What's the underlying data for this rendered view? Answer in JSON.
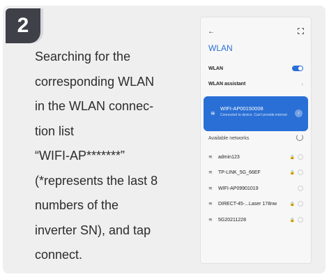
{
  "step": {
    "number": "2"
  },
  "instruction": {
    "lines": [
      "Searching for the",
      "corresponding WLAN",
      "in the WLAN connec-",
      "tion list",
      "“WIFI-AP*******”",
      "(*represents the last 8",
      "numbers of the",
      "inverter SN), and tap",
      "connect."
    ]
  },
  "phone": {
    "back": "←",
    "title": "WLAN",
    "wlan_label": "WLAN",
    "wlan_assistant": "WLAN assistant",
    "connected": {
      "ssid": "WIFI-AP00150008",
      "status": "Connected to device. Can't provide internet"
    },
    "available_label": "Available networks",
    "networks": [
      {
        "ssid": "admin123",
        "lock": "🔒"
      },
      {
        "ssid": "TP-LINK_5G_66EF",
        "lock": "🔒"
      },
      {
        "ssid": "WIFI-AP09901019",
        "lock": ""
      },
      {
        "ssid": "DIRECT-45-...Laser 178nw",
        "lock": "🔒"
      },
      {
        "ssid": "5G20211228",
        "lock": "🔒"
      }
    ]
  },
  "colors": {
    "accent": "#2a6fd6",
    "badge": "#3f4048",
    "card": "#efeff0"
  }
}
